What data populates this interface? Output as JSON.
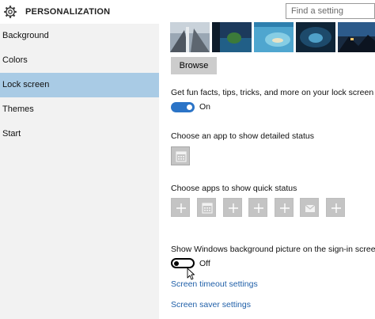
{
  "header": {
    "title": "PERSONALIZATION",
    "search_placeholder": "Find a setting",
    "icon": "gear-icon"
  },
  "sidebar": {
    "items": [
      {
        "label": "Background",
        "active": false
      },
      {
        "label": "Colors",
        "active": false
      },
      {
        "label": "Lock screen",
        "active": true
      },
      {
        "label": "Themes",
        "active": false
      },
      {
        "label": "Start",
        "active": false
      }
    ],
    "active_color": "#a9cbe5"
  },
  "main": {
    "browse_label": "Browse",
    "fun_facts": {
      "label": "Get fun facts, tips, tricks, and more on your lock screen",
      "toggle_state": "On"
    },
    "detailed_status": {
      "label": "Choose an app to show detailed status",
      "app": "calendar-icon"
    },
    "quick_status": {
      "label": "Choose apps to show quick status",
      "apps": [
        "plus-icon",
        "calendar-icon",
        "plus-icon",
        "plus-icon",
        "plus-icon",
        "mail-icon",
        "plus-icon"
      ]
    },
    "signin_background": {
      "label": "Show Windows background picture on the sign-in screen",
      "toggle_state": "Off"
    },
    "links": {
      "screen_timeout": "Screen timeout settings",
      "screen_saver": "Screen saver settings"
    }
  },
  "colors": {
    "accent": "#2b74c7",
    "link": "#1f5fa8",
    "tile": "#c4c4c4"
  }
}
